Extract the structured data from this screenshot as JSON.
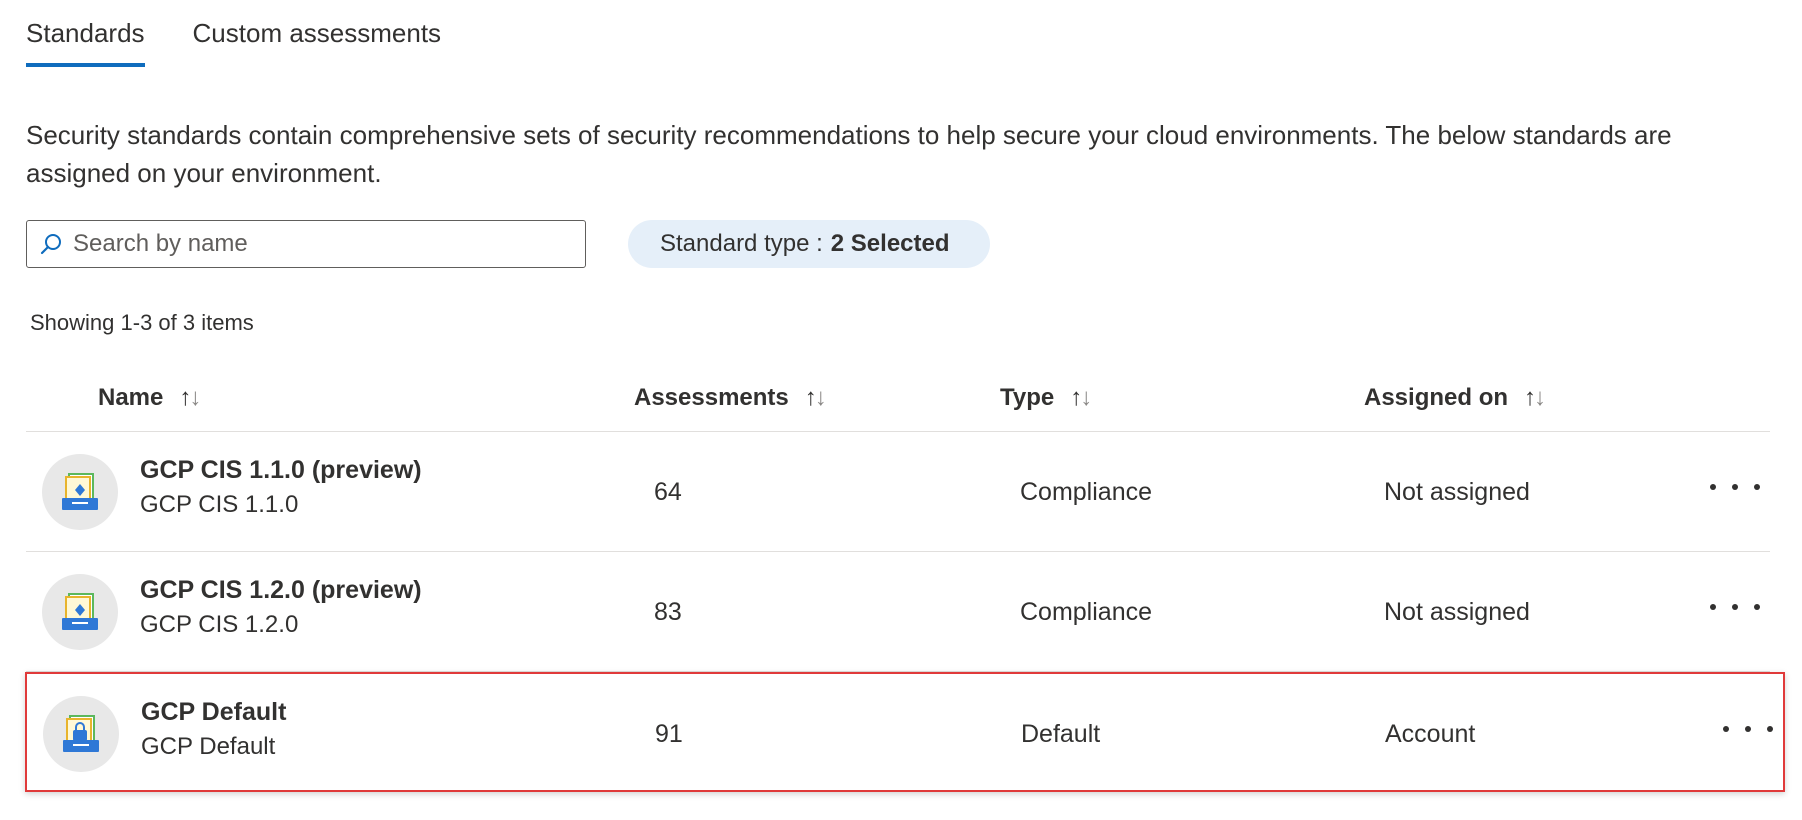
{
  "tabs": [
    {
      "label": "Standards",
      "active": true
    },
    {
      "label": "Custom assessments",
      "active": false
    }
  ],
  "description": "Security standards contain comprehensive sets of security recommendations to help secure your cloud environments. The below standards are assigned on your environment.",
  "search": {
    "placeholder": "Search by name",
    "value": "",
    "icon": "search-icon"
  },
  "filter": {
    "label": "Standard type :",
    "selected": "2 Selected"
  },
  "results_count": "Showing 1-3 of 3 items",
  "columns": [
    {
      "label": "Name",
      "sort_icon": "↑↓"
    },
    {
      "label": "Assessments",
      "sort_icon": "↑↓"
    },
    {
      "label": "Type",
      "sort_icon": "↑↓"
    },
    {
      "label": "Assigned on",
      "sort_icon": "↑↓"
    }
  ],
  "rows": [
    {
      "title": "GCP CIS 1.1.0 (preview)",
      "subtitle": "GCP CIS 1.1.0",
      "assessments": "64",
      "type": "Compliance",
      "assigned_on": "Not assigned",
      "icon": "compliance-standard-icon"
    },
    {
      "title": "GCP CIS 1.2.0 (preview)",
      "subtitle": "GCP CIS 1.2.0",
      "assessments": "83",
      "type": "Compliance",
      "assigned_on": "Not assigned",
      "icon": "compliance-standard-icon"
    },
    {
      "title": "GCP Default",
      "subtitle": "GCP Default",
      "assessments": "91",
      "type": "Default",
      "assigned_on": "Account",
      "icon": "default-standard-lock-icon",
      "highlighted": true
    }
  ],
  "colors": {
    "accent": "#0f6cbd",
    "highlight_border": "#e03a3a",
    "filter_bg": "#e5eff9"
  }
}
